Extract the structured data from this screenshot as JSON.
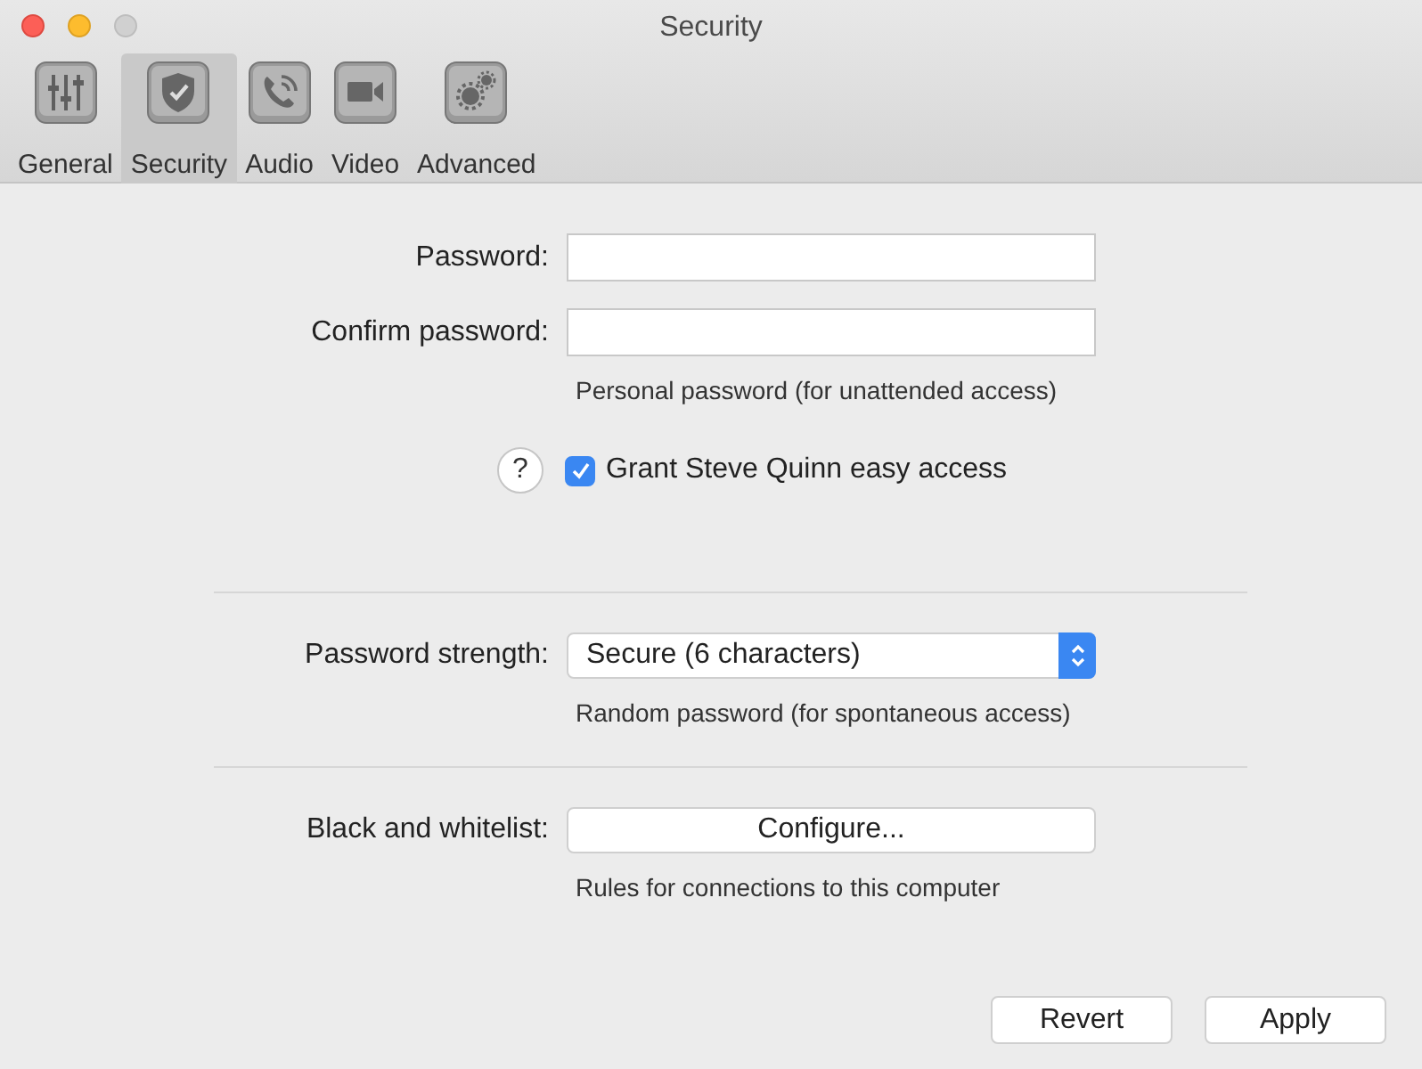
{
  "window": {
    "title": "Security"
  },
  "tabs": [
    {
      "label": "General",
      "selected": false
    },
    {
      "label": "Security",
      "selected": true
    },
    {
      "label": "Audio",
      "selected": false
    },
    {
      "label": "Video",
      "selected": false
    },
    {
      "label": "Advanced",
      "selected": false
    }
  ],
  "password": {
    "label": "Password:"
  },
  "confirm": {
    "label": "Confirm password:",
    "hint": "Personal password (for unattended access)"
  },
  "easy_access": {
    "help": "?",
    "label": "Grant Steve Quinn easy access",
    "checked": true
  },
  "strength": {
    "label": "Password strength:",
    "value": "Secure (6 characters)",
    "hint": "Random password (for spontaneous access)"
  },
  "whitelist": {
    "label": "Black and whitelist:",
    "button": "Configure...",
    "hint": "Rules for connections to this computer"
  },
  "buttons": [
    "Revert",
    "Apply"
  ]
}
